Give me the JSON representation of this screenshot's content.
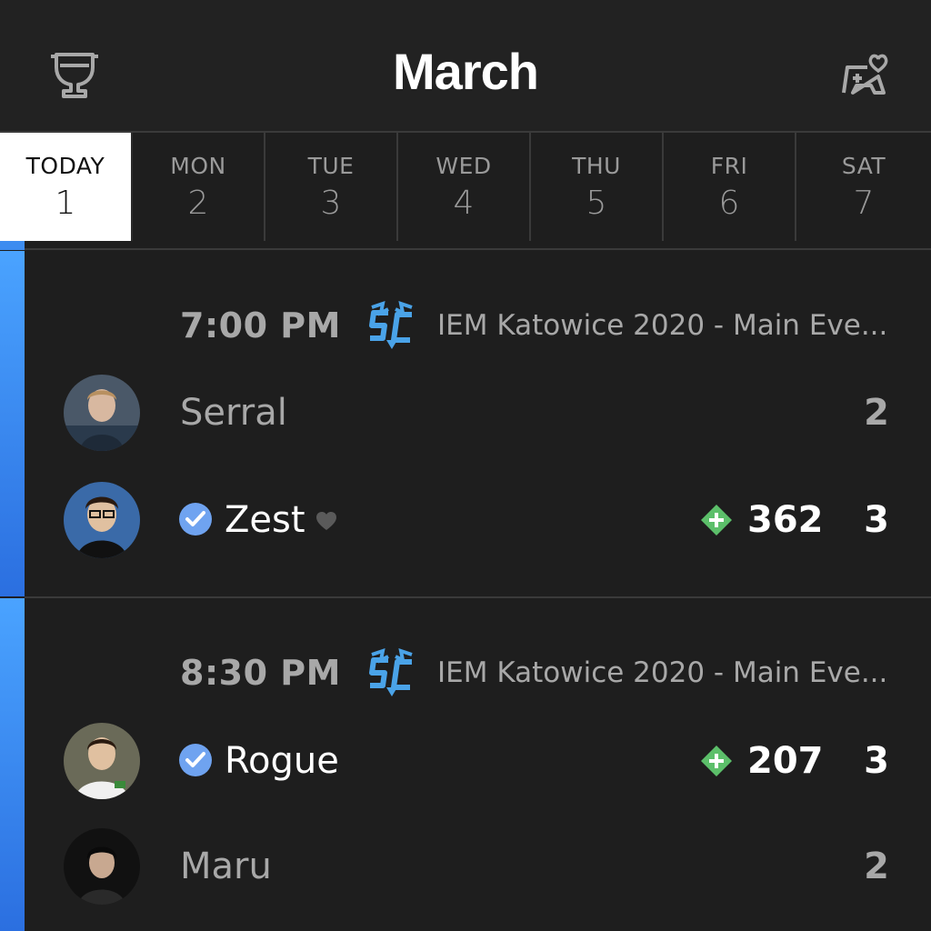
{
  "header": {
    "title": "March",
    "left_icon": "trophy-icon",
    "right_icon": "gamepad-heart-icon"
  },
  "days": [
    {
      "name": "TODAY",
      "num": "1",
      "active": true
    },
    {
      "name": "MON",
      "num": "2"
    },
    {
      "name": "TUE",
      "num": "3"
    },
    {
      "name": "WED",
      "num": "4"
    },
    {
      "name": "THU",
      "num": "5"
    },
    {
      "name": "FRI",
      "num": "6"
    },
    {
      "name": "SAT",
      "num": "7"
    }
  ],
  "matches": [
    {
      "time": "7:00 PM",
      "game_icon": "starcraft2-icon",
      "event": "IEM Katowice 2020 - Main Eve...",
      "players": [
        {
          "name": "Serral",
          "score": "2",
          "winner": false,
          "verified": false
        },
        {
          "name": "Zest",
          "score": "3",
          "winner": true,
          "verified": true,
          "favorite": true,
          "rating": "362"
        }
      ]
    },
    {
      "time": "8:30 PM",
      "game_icon": "starcraft2-icon",
      "event": "IEM Katowice 2020 - Main Eve...",
      "players": [
        {
          "name": "Rogue",
          "score": "3",
          "winner": true,
          "verified": true,
          "rating": "207"
        },
        {
          "name": "Maru",
          "score": "2",
          "winner": false,
          "verified": false
        }
      ]
    }
  ],
  "colors": {
    "accent": "#3d8cf0",
    "background": "#1e1e1e",
    "rating_plus": "#5cbf6a",
    "verified": "#6fa3f0"
  }
}
